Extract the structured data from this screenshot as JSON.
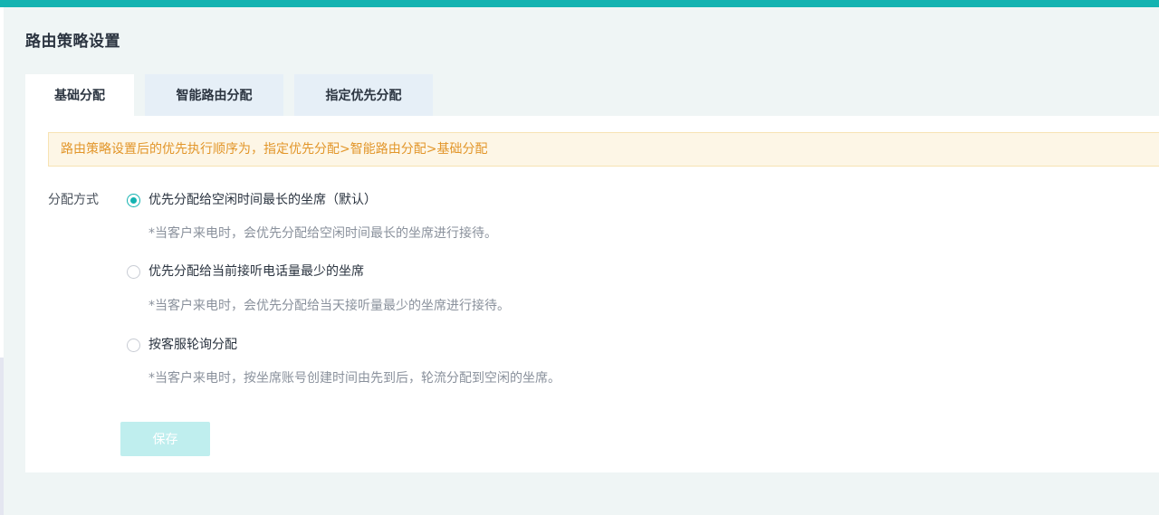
{
  "page": {
    "title": "路由策略设置"
  },
  "tabs": [
    {
      "label": "基础分配",
      "active": true
    },
    {
      "label": "智能路由分配",
      "active": false
    },
    {
      "label": "指定优先分配",
      "active": false
    }
  ],
  "notice": {
    "text": "路由策略设置后的优先执行顺序为，指定优先分配>智能路由分配>基础分配"
  },
  "form": {
    "field_label": "分配方式",
    "options": [
      {
        "label": "优先分配给空闲时间最长的坐席（默认）",
        "hint": "*当客户来电时，会优先分配给空闲时间最长的坐席进行接待。",
        "checked": true
      },
      {
        "label": "优先分配给当前接听电话量最少的坐席",
        "hint": "*当客户来电时，会优先分配给当天接听量最少的坐席进行接待。",
        "checked": false
      },
      {
        "label": "按客服轮询分配",
        "hint": "*当客户来电时，按坐席账号创建时间由先到后，轮流分配到空闲的坐席。",
        "checked": false
      }
    ],
    "save_label": "保存"
  },
  "colors": {
    "accent": "#14b3b1",
    "notice_text": "#e2962a",
    "notice_bg": "#fdf6e6",
    "save_disabled_bg": "#bfeeee"
  }
}
